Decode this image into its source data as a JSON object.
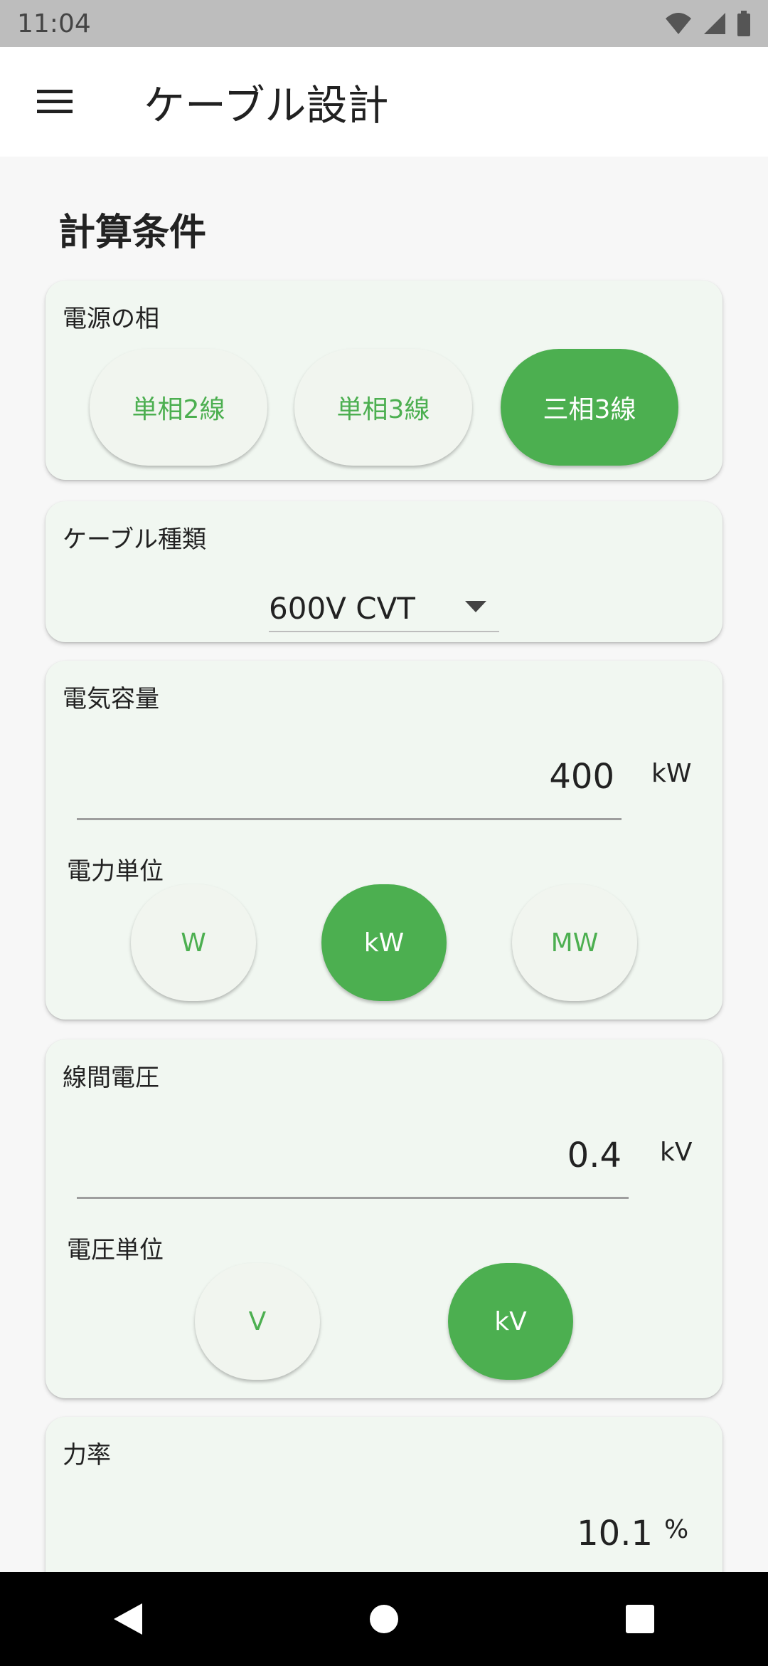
{
  "status_bar": {
    "time": "11:04",
    "icons": [
      "wifi-icon",
      "cell-signal-icon",
      "battery-icon"
    ]
  },
  "app_bar": {
    "menu_icon": "hamburger-menu-icon",
    "title": "ケーブル設計"
  },
  "section": {
    "title": "計算条件"
  },
  "power_phase": {
    "label": "電源の相",
    "options": [
      "単相2線",
      "単相3線",
      "三相3線"
    ],
    "selected": "三相3線"
  },
  "cable_type": {
    "label": "ケーブル種類",
    "value": "600V CVT"
  },
  "capacity": {
    "label": "電気容量",
    "value": "400",
    "unit": "kW",
    "unit_section_label": "電力単位",
    "unit_options": [
      "W",
      "kW",
      "MW"
    ],
    "unit_selected": "kW"
  },
  "voltage": {
    "label": "線間電圧",
    "value": "0.4",
    "unit": "kV",
    "unit_section_label": "電圧単位",
    "unit_options": [
      "V",
      "kV"
    ],
    "unit_selected": "kV"
  },
  "power_factor": {
    "label": "力率",
    "value": "10.1",
    "unit": "%"
  },
  "nav_bar": {
    "buttons": [
      "back-icon",
      "home-icon",
      "recents-icon"
    ]
  },
  "colors": {
    "accent": "#4caf50",
    "card_bg": "#f1f7f1",
    "status_bar": "#bdbdbd",
    "nav_bar": "#000000"
  }
}
